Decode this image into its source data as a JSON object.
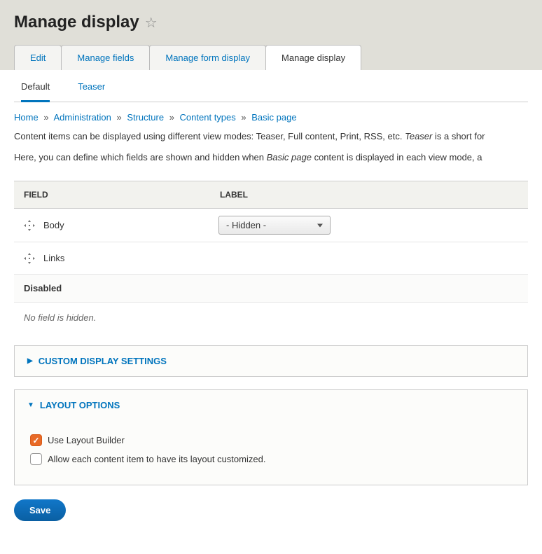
{
  "page_title": "Manage display",
  "primary_tabs": [
    {
      "label": "Edit",
      "active": false
    },
    {
      "label": "Manage fields",
      "active": false
    },
    {
      "label": "Manage form display",
      "active": false
    },
    {
      "label": "Manage display",
      "active": true
    }
  ],
  "secondary_tabs": [
    {
      "label": "Default",
      "active": true
    },
    {
      "label": "Teaser",
      "active": false
    }
  ],
  "breadcrumb": {
    "items": [
      "Home",
      "Administration",
      "Structure",
      "Content types",
      "Basic page"
    ],
    "sep": "»"
  },
  "desc1_pre": "Content items can be displayed using different view modes: Teaser, Full content, Print, RSS, etc. ",
  "desc1_em": "Teaser",
  "desc1_post": " is a short for",
  "desc2_pre": "Here, you can define which fields are shown and hidden when ",
  "desc2_em": "Basic page",
  "desc2_post": " content is displayed in each view mode, a",
  "table": {
    "col_field": "FIELD",
    "col_label": "LABEL",
    "rows": [
      {
        "name": "Body",
        "label_select": "- Hidden -",
        "has_select": true
      },
      {
        "name": "Links",
        "label_select": "",
        "has_select": false
      }
    ],
    "disabled_heading": "Disabled",
    "empty_text": "No field is hidden."
  },
  "details_custom": {
    "title": "CUSTOM DISPLAY SETTINGS",
    "open": false
  },
  "details_layout": {
    "title": "LAYOUT OPTIONS",
    "open": true,
    "use_layout_builder": {
      "label": "Use Layout Builder",
      "checked": true
    },
    "allow_custom": {
      "label": "Allow each content item to have its layout customized.",
      "checked": false
    }
  },
  "save_label": "Save"
}
